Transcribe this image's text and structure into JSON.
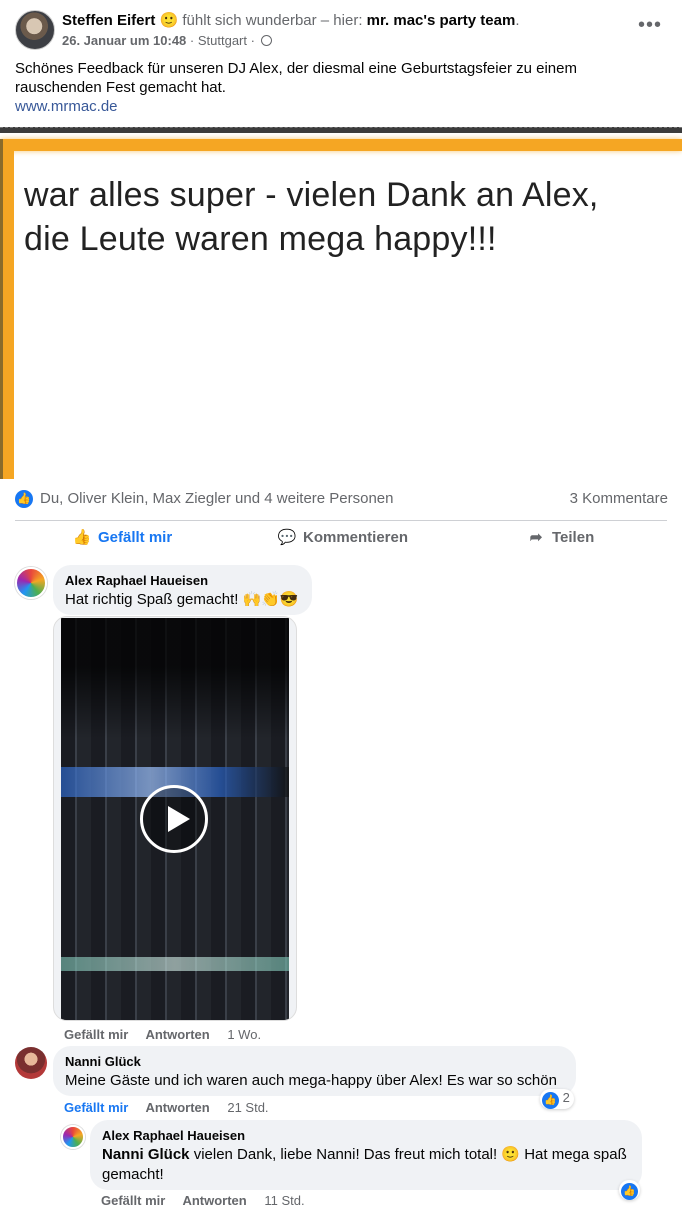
{
  "post": {
    "author": "Steffen Eifert",
    "feeling_emoji": "🙂",
    "feeling_text": "fühlt sich wunderbar – hier:",
    "page": "mr. mac's party team",
    "page_suffix": ".",
    "date": "26. Januar um 10:48",
    "location": "· Stuttgart ·",
    "more_icon": "•••",
    "text": "Schönes Feedback für unseren DJ Alex, der diesmal eine Geburtstagsfeier zu einem rauschenden Fest gemacht hat.",
    "link": "www.mrmac.de",
    "image_quote_line1": "war alles super - vielen Dank an Alex,",
    "image_quote_line2": "die Leute waren mega happy!!!"
  },
  "reactions": {
    "like_icon": "👍",
    "summary": "Du, Oliver Klein, Max Ziegler und 4 weitere Personen",
    "comments": "3 Kommentare"
  },
  "actions": {
    "like": "Gefällt mir",
    "comment": "Kommentieren",
    "share": "Teilen",
    "like_icon": "👍",
    "comment_icon": "💬",
    "share_icon": "➦"
  },
  "comments": [
    {
      "author": "Alex Raphael Haueisen",
      "text": "Hat richtig Spaß gemacht! 🙌👏😎",
      "like": "Gefällt mir",
      "reply": "Antworten",
      "time": "1 Wo."
    },
    {
      "author": "Nanni Glück",
      "text": "Meine Gäste und ich waren auch mega-happy über Alex! Es war so schön",
      "like": "Gefällt mir",
      "reply": "Antworten",
      "time": "21 Std.",
      "reaction_count": "2"
    },
    {
      "author": "Alex Raphael Haueisen",
      "mention": "Nanni Glück",
      "text": " vielen Dank, liebe Nanni! Das freut mich total! 🙂 Hat mega spaß gemacht!",
      "like": "Gefällt mir",
      "reply": "Antworten",
      "time": "11 Std."
    }
  ],
  "colors": {
    "accent": "#1877f2",
    "secondary_text": "#65676b",
    "bubble": "#f0f2f5",
    "image_border": "#f5a623"
  }
}
